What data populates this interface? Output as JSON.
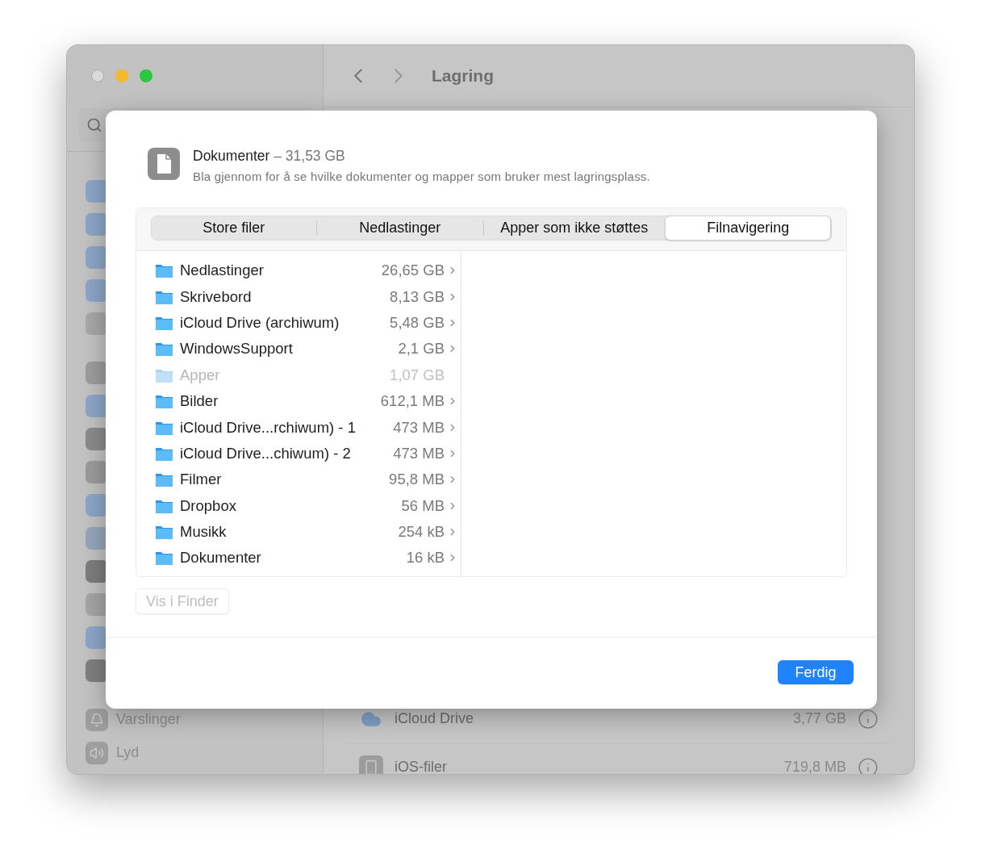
{
  "window": {
    "title": "Lagring"
  },
  "sidebar": {
    "items": [
      {
        "label": "Varslinger",
        "kind": "bell"
      },
      {
        "label": "Lyd",
        "kind": "sound"
      }
    ]
  },
  "storage_list": [
    {
      "name": "iCloud Drive",
      "size": "3,77 GB",
      "kind": "cloud"
    },
    {
      "name": "iOS-filer",
      "size": "719,8 MB",
      "kind": "phone"
    }
  ],
  "dialog": {
    "title": "Dokumenter",
    "total": "– 31,53 GB",
    "description": "Bla gjennom for å se hvilke dokumenter og mapper som bruker mest lagringsplass.",
    "tabs": [
      {
        "label": "Store filer",
        "selected": false
      },
      {
        "label": "Nedlastinger",
        "selected": false
      },
      {
        "label": "Apper som ikke støttes",
        "selected": false
      },
      {
        "label": "Filnavigering",
        "selected": true
      }
    ],
    "rows": [
      {
        "name": "Nedlastinger",
        "size": "26,65 GB",
        "disabled": false
      },
      {
        "name": "Skrivebord",
        "size": "8,13 GB",
        "disabled": false
      },
      {
        "name": "iCloud Drive (archiwum)",
        "size": "5,48 GB",
        "disabled": false
      },
      {
        "name": "WindowsSupport",
        "size": "2,1 GB",
        "disabled": false
      },
      {
        "name": "Apper",
        "size": "1,07 GB",
        "disabled": true
      },
      {
        "name": "Bilder",
        "size": "612,1 MB",
        "disabled": false
      },
      {
        "name": "iCloud Drive...rchiwum) - 1",
        "size": "473 MB",
        "disabled": false
      },
      {
        "name": "iCloud Drive...chiwum) - 2",
        "size": "473 MB",
        "disabled": false
      },
      {
        "name": "Filmer",
        "size": "95,8 MB",
        "disabled": false
      },
      {
        "name": "Dropbox",
        "size": "56 MB",
        "disabled": false
      },
      {
        "name": "Musikk",
        "size": "254 kB",
        "disabled": false
      },
      {
        "name": "Dokumenter",
        "size": "16 kB",
        "disabled": false
      }
    ],
    "finder_button": {
      "label": "Vis i Finder",
      "disabled": true
    },
    "done_button": {
      "label": "Ferdig"
    }
  }
}
